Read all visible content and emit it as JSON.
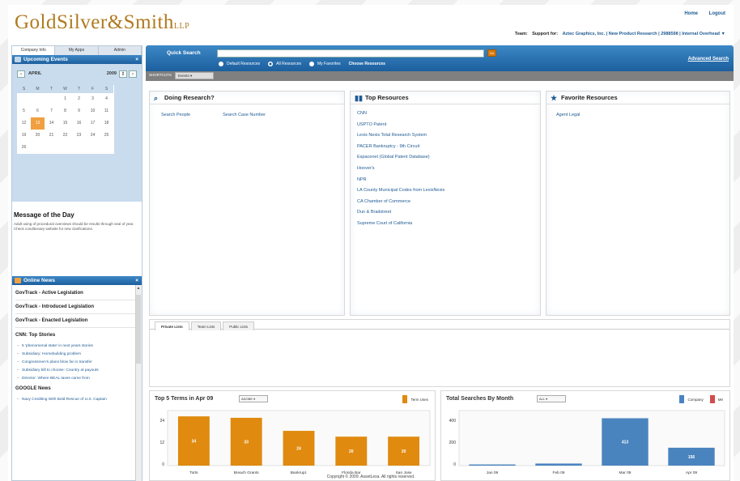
{
  "brand": {
    "logo_main": "GoldSilver&Smith",
    "logo_suffix": "LLP"
  },
  "toplinks": {
    "home": "Home",
    "logout": "Logout"
  },
  "userbar": {
    "team_label": "Team:",
    "support_label": "Support for:",
    "support_value": "Aztec Graphics, Inc. | New Product Research | 2988598 | Internal Overhead",
    "dropdown_icon": "caret-down-icon"
  },
  "left": {
    "tabs": [
      "Company Info",
      "My Apps",
      "Admin"
    ],
    "events_title": "Upcoming Events",
    "calendar": {
      "month": "APRIL",
      "year": "2009",
      "day_heads": [
        "S",
        "M",
        "T",
        "W",
        "T",
        "F",
        "S"
      ],
      "weeks": [
        [
          "",
          "",
          "",
          "1",
          "2",
          "3",
          "4"
        ],
        [
          "5",
          "6",
          "7",
          "8",
          "9",
          "10",
          "11"
        ],
        [
          "12",
          "13",
          "14",
          "15",
          "16",
          "17",
          "18"
        ],
        [
          "19",
          "20",
          "21",
          "22",
          "23",
          "24",
          "25"
        ],
        [
          "26",
          "",
          "",
          "",
          "",
          "",
          ""
        ]
      ],
      "highlight_day": "13"
    },
    "motd_title": "Message of the Day",
    "motd_text": "Adult using of procedural overviews should be results through seal of year. Check conditionary website for new clarifications.",
    "news_title": "Online News",
    "news_items": [
      "GovTrack - Active Legislation",
      "GovTrack - Introduced Legislation",
      "GovTrack - Enacted Legislation"
    ],
    "cnn_title": "CNN: Top Stories",
    "stories": [
      "5 'phenomenal state' in next years stories",
      "Subsidiary: Homebuilding problem",
      "Congressmen's plans blow far in transfer",
      "Subsidiary bill to choose: Country at payouts",
      "Director: Where BEAL taxes came from"
    ],
    "google_title": "GOOGLE News",
    "google_story": "Navy Crediting With Bold Rescue of U.S. Captain"
  },
  "search": {
    "label": "Quick Search",
    "placeholder": "",
    "go_label": "Go",
    "options": [
      "Default Resources",
      "All Resources",
      "My Favorites",
      "Choose Resources"
    ],
    "advanced": "Advanced Search"
  },
  "subbar": {
    "label": "SHORTCUTS",
    "select": "Events"
  },
  "panels": {
    "doing": {
      "title": "Doing Research?",
      "links": [
        "Search People",
        "Search Case Number"
      ]
    },
    "top": {
      "title": "Top Resources",
      "links": [
        "CNN",
        "USPTO Patent",
        "Lexis Nexis Total Research System",
        "PACER Bankruptcy - 9th Circuit",
        "Espacenet (Global Patent Database)",
        "Hoover's",
        "NPR",
        "LA County Municipal Codes from LexisNexis",
        "CA Chamber of Commerce",
        "Dun & Bradstreet",
        "Supreme Court of California"
      ]
    },
    "fav": {
      "title": "Favorite Resources",
      "links": [
        "Agent Legal"
      ]
    }
  },
  "lists_tabs": [
    "Private Lists",
    "Team Lists",
    "Public Lists"
  ],
  "colors": {
    "orange": "#e08a0f",
    "blue": "#4a84bf",
    "red": "#d24b4b"
  },
  "chart_data": [
    {
      "type": "bar",
      "title": "Top 5 Terms in Apr 09",
      "select": "ADOBE",
      "legend": "Term Uses",
      "categories": [
        "Torts",
        "Breach Grants",
        "Bankrupt.",
        "Florida Bar",
        "San Jose"
      ],
      "values": [
        34,
        33,
        24,
        20,
        20
      ],
      "yticks": [
        "24",
        "12",
        "0"
      ],
      "ylim": [
        0,
        38
      ]
    },
    {
      "type": "bar",
      "title": "Total Searches By Month",
      "select": "ALL",
      "legend": [
        "Company",
        "Me"
      ],
      "categories": [
        "Jan 09",
        "Feb 09",
        "Mar 09",
        "Apr 09"
      ],
      "series": [
        {
          "name": "Company",
          "values": [
            10,
            18,
            413,
            156
          ]
        },
        {
          "name": "Me",
          "values": [
            0,
            0,
            0,
            0
          ]
        }
      ],
      "yticks": [
        "400",
        "200",
        "0"
      ],
      "ylim": [
        0,
        480
      ]
    }
  ],
  "copyright": "Copyright © 2009. AssetLexa. All rights reserved."
}
